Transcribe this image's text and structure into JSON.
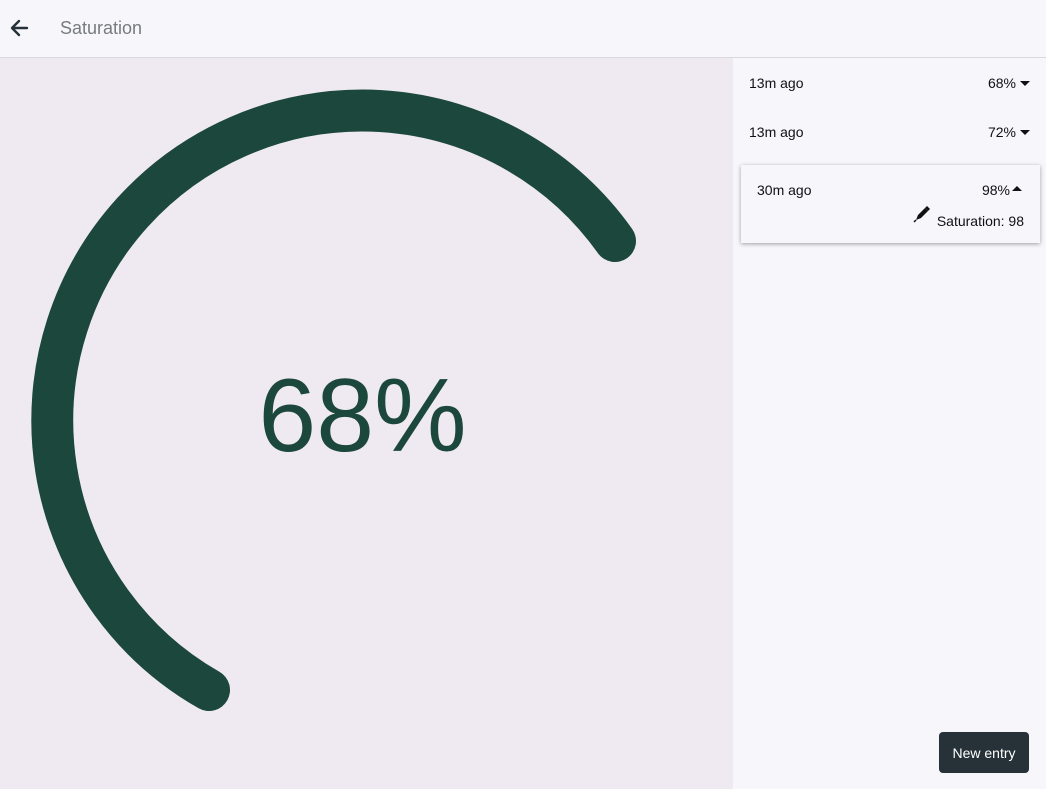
{
  "header": {
    "title": "Saturation",
    "back_icon": "arrow-left-icon"
  },
  "gauge": {
    "value_label": "68%",
    "level_percent": 68,
    "color": "#1c473c",
    "track_background": "#efeaf1"
  },
  "history": {
    "entries": [
      {
        "time": "13m ago",
        "value": "68%",
        "expanded": false
      },
      {
        "time": "13m ago",
        "value": "72%",
        "expanded": false
      },
      {
        "time": "30m ago",
        "value": "98%",
        "expanded": true,
        "detail": "Saturation: 98",
        "detail_icon": "pen-icon"
      }
    ]
  },
  "actions": {
    "new_entry_label": "New entry",
    "button_color": "#263238"
  }
}
